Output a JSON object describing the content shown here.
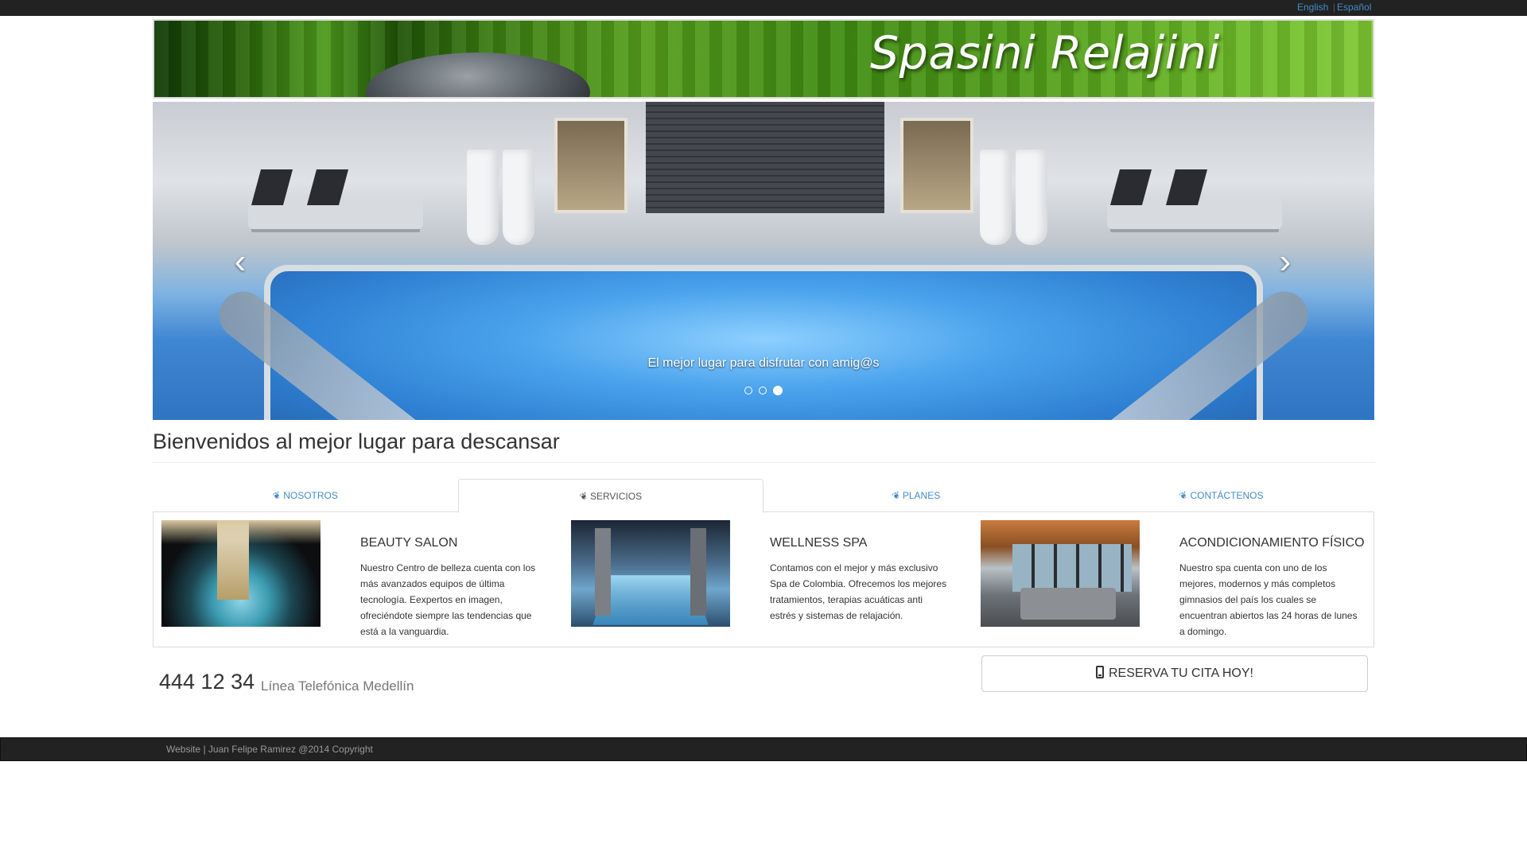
{
  "topbar": {
    "english": "English",
    "espanol": "Español",
    "separator": "|"
  },
  "banner": {
    "brand": "Spasini Relajini"
  },
  "carousel": {
    "caption": "El mejor lugar para disfrutar con amig@s",
    "prev_icon": "chevron-left-icon",
    "next_icon": "chevron-right-icon",
    "prev_glyph": "‹",
    "next_glyph": "›",
    "slides_count": 3,
    "active_index": 2
  },
  "welcome": {
    "heading": "Bienvenidos al mejor lugar para descansar"
  },
  "tabs": [
    {
      "label": "NOSOTROS",
      "icon": "leaf-icon",
      "active": false
    },
    {
      "label": "SERVICIOS",
      "icon": "leaf-icon",
      "active": true
    },
    {
      "label": "PLANES",
      "icon": "leaf-icon",
      "active": false
    },
    {
      "label": "CONTÁCTENOS",
      "icon": "leaf-icon",
      "active": false
    }
  ],
  "services": [
    {
      "title": "BEAUTY SALON",
      "text": "Nuestro Centro de belleza cuenta con los más avanzados equipos de última tecnología. Eexpertos en imagen, ofreciéndote siempre las tendencias que está a la vanguardia."
    },
    {
      "title": "WELLNESS SPA",
      "text": "Contamos con el mejor y más exclusivo Spa de Colombia. Ofrecemos los mejores tratamientos, terapias acuáticas anti estrés y sistemas de relajación."
    },
    {
      "title": "ACONDICIONAMIENTO FÍSICO",
      "text": "Nuestro spa cuenta con uno de los mejores, modernos y más completos gimnasios del país los cuales se encuentran abiertos las 24 horas de lunes a domingo."
    }
  ],
  "contact": {
    "phone": "444 12 34",
    "phone_label": "Línea Telefónica Medellín"
  },
  "cta": {
    "label": "RESERVA TU CITA HOY!",
    "icon": "mobile-phone-icon"
  },
  "footer": {
    "text": "Website | Juan Felipe Ramirez @2014 Copyright"
  },
  "colors": {
    "link": "#428bca",
    "topbar": "#222222",
    "footer": "#222222",
    "banner_green": "#4e9c18"
  }
}
